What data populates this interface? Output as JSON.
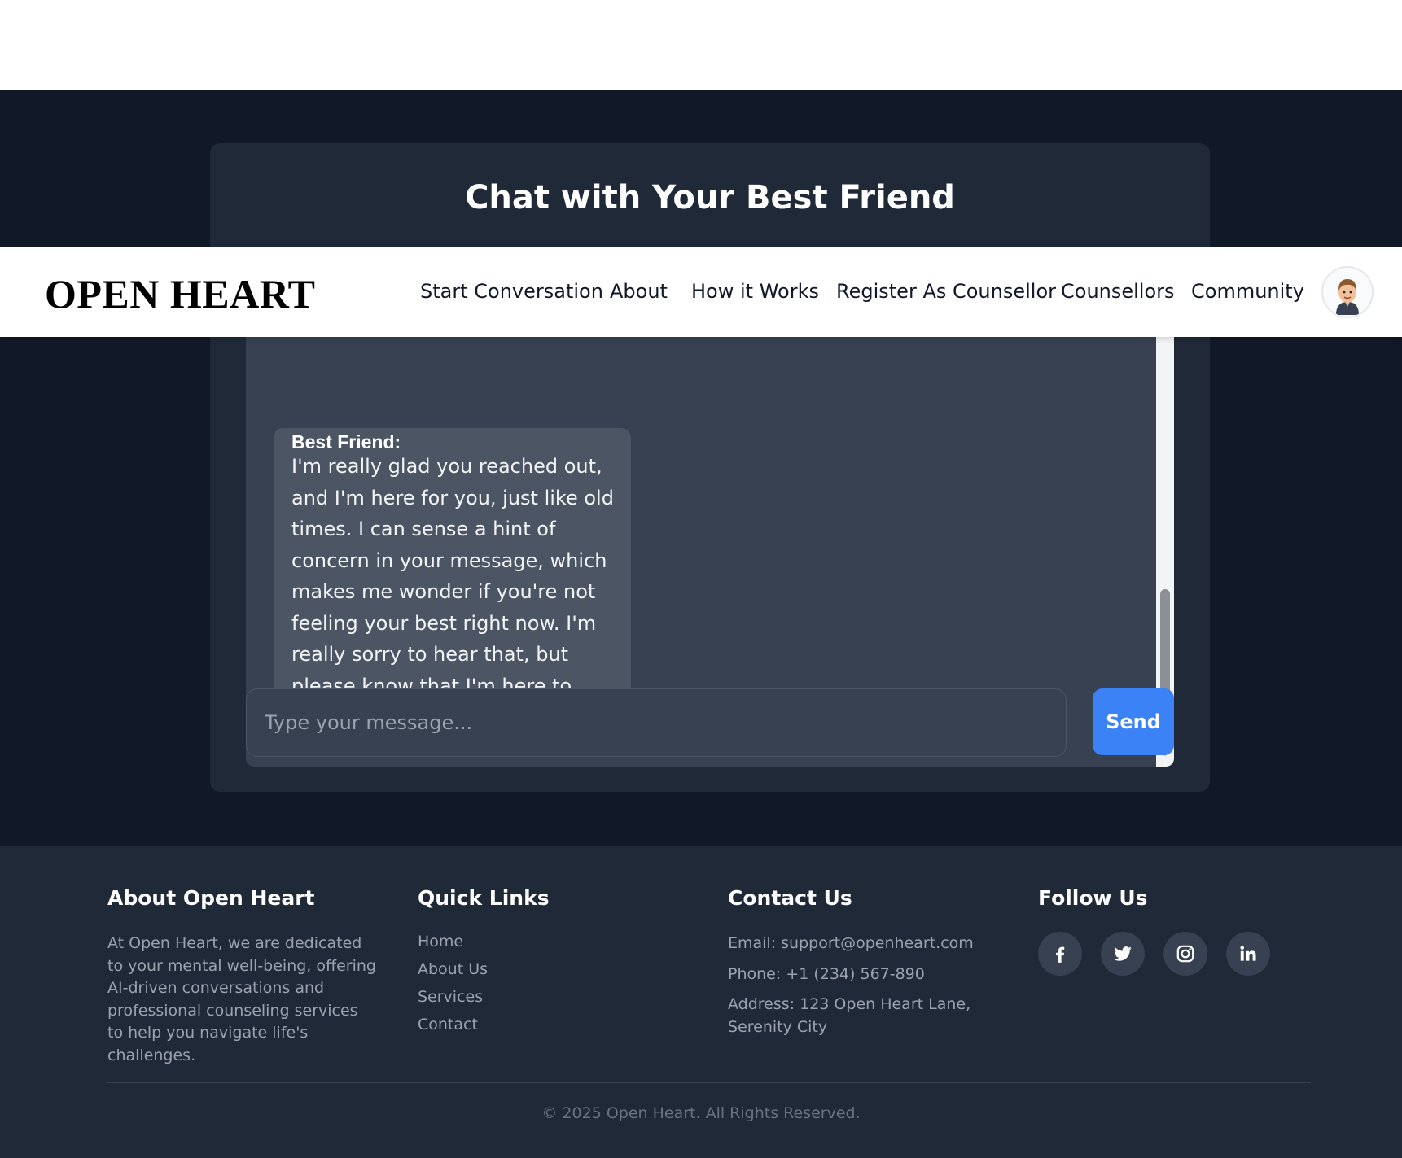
{
  "chat": {
    "title": "Chat with Your Best Friend",
    "message": {
      "sender": "Best Friend:",
      "text": "I'm really glad you reached out, and I'm here for you, just like old times. I can sense a hint of concern in your message, which makes me wonder if you're not feeling your best right now. I'm really sorry to hear that, but please know that I'm here to listen without judgment."
    },
    "input_placeholder": "Type your message...",
    "input_value": "",
    "send_label": "Send"
  },
  "nav": {
    "logo": "OPEN HEART",
    "items": [
      {
        "label": "Start Conversation"
      },
      {
        "label": "About"
      },
      {
        "label": "How it Works"
      },
      {
        "label": "Register As Counsellor"
      },
      {
        "label": "Counsellors"
      },
      {
        "label": "Community"
      }
    ]
  },
  "footer": {
    "about": {
      "heading": "About Open Heart",
      "text": "At Open Heart, we are dedicated to your mental well-being, offering AI-driven conversations and professional counseling services to help you navigate life's challenges."
    },
    "quick_links": {
      "heading": "Quick Links",
      "links": [
        "Home",
        "About Us",
        "Services",
        "Contact"
      ]
    },
    "contact": {
      "heading": "Contact Us",
      "email": "Email: support@openheart.com",
      "phone": "Phone: +1 (234) 567-890",
      "address": "Address: 123 Open Heart Lane, Serenity City"
    },
    "follow": {
      "heading": "Follow Us",
      "icons": [
        "facebook-icon",
        "twitter-icon",
        "instagram-icon",
        "linkedin-icon"
      ]
    },
    "copyright": "© 2025 Open Heart. All Rights Reserved."
  },
  "colors": {
    "page_bg": "#111827",
    "card_bg": "#1f2937",
    "message_area": "#374151",
    "bubble": "#4b5563",
    "accent": "#3b82f6"
  }
}
